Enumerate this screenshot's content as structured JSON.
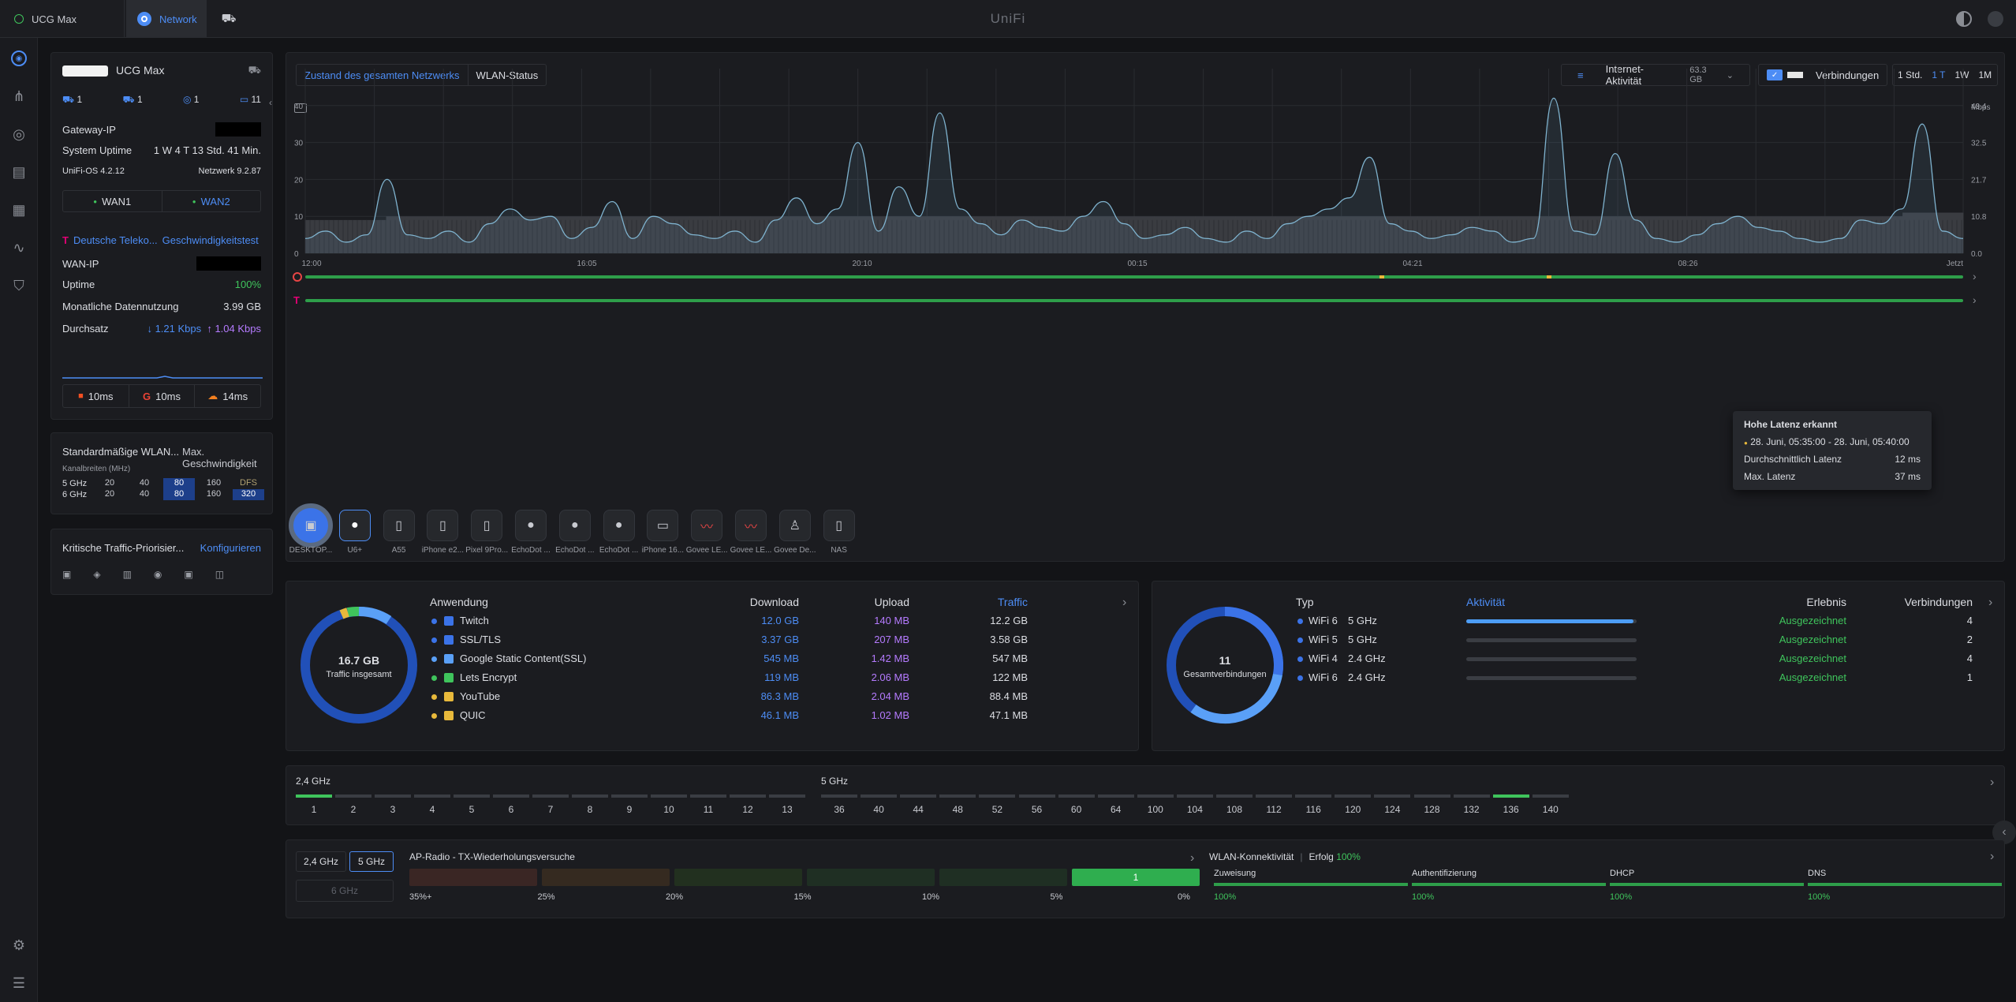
{
  "topbar": {
    "device_tab": "UCG Max",
    "network_tab": "Network",
    "brand": "UniFi"
  },
  "gateway": {
    "name": "UCG Max",
    "counts": [
      "1",
      "1",
      "1",
      "11"
    ],
    "gateway_ip_label": "Gateway-IP",
    "uptime_label": "System Uptime",
    "uptime_value": "1 W 4 T 13 Std. 41 Min.",
    "os_label": "UniFi-OS 4.2.12",
    "network_label": "Netzwerk 9.2.87",
    "wan1": "WAN1",
    "wan2": "WAN2"
  },
  "wan": {
    "isp": "Deutsche Teleko...",
    "speedtest": "Geschwindigkeitstest",
    "wan_ip_label": "WAN-IP",
    "uptime_label": "Uptime",
    "uptime_value": "100%",
    "usage_label": "Monatliche Datennutzung",
    "usage_value": "3.99 GB",
    "throughput_label": "Durchsatz",
    "down": "↓ 1.21 Kbps",
    "up": "↑ 1.04 Kbps",
    "latencies": [
      "10ms",
      "10ms",
      "14ms"
    ]
  },
  "wlan": {
    "title": "Standardmäßige WLAN...",
    "max_speed": "Max. Geschwindigkeit",
    "channel_widths": "Kanalbreiten (MHz)",
    "rows": [
      {
        "band": "5 GHz",
        "values": [
          "20",
          "40",
          "80",
          "160",
          "DFS"
        ]
      },
      {
        "band": "6 GHz",
        "values": [
          "20",
          "40",
          "80",
          "160",
          "320"
        ]
      }
    ]
  },
  "traffic_prio": {
    "title": "Kritische Traffic-Priorisier...",
    "action": "Konfigurieren"
  },
  "chart_toolbar": {
    "tab_overall": "Zustand des gesamten Netzwerks",
    "tab_wlan": "WLAN-Status",
    "internet_activity": "Internet-Aktivität",
    "total": "63.3 GB",
    "connections": "Verbindungen",
    "ranges": [
      "1 Std.",
      "1 T",
      "1W",
      "1M"
    ],
    "unit_right": "Mbps"
  },
  "chart_data": {
    "type": "area",
    "x_ticks": [
      "12:00",
      "16:05",
      "20:10",
      "00:15",
      "04:21",
      "08:26",
      "Jetzt"
    ],
    "y_left_ticks": [
      "0",
      "10",
      "20",
      "30",
      "40"
    ],
    "y_right_ticks": [
      "0.0",
      "10.8",
      "21.7",
      "32.5",
      "43.4"
    ],
    "ylabel_right": "Mbps",
    "series": [
      {
        "name": "Internet-Aktivität",
        "values": [
          4,
          6,
          3,
          5,
          20,
          5,
          4,
          6,
          3,
          8,
          12,
          9,
          10,
          4,
          7,
          14,
          4,
          10,
          8,
          5,
          4,
          6,
          3,
          9,
          15,
          8,
          12,
          30,
          6,
          18,
          10,
          38,
          12,
          8,
          5,
          9,
          7,
          6,
          10,
          14,
          8,
          4,
          5,
          7,
          4,
          3,
          6,
          4,
          8,
          10,
          12,
          15,
          26,
          8,
          6,
          4,
          5,
          7,
          6,
          3,
          4,
          42,
          6,
          5,
          27,
          9,
          4,
          3,
          5,
          8,
          10,
          7,
          6,
          4,
          3,
          4,
          9,
          8,
          12,
          35,
          6,
          4
        ]
      },
      {
        "name": "Verbindungen",
        "values": [
          9,
          9,
          9,
          9,
          10,
          10,
          10,
          10,
          10,
          10,
          10,
          10,
          10,
          10,
          10,
          10,
          10,
          10,
          10,
          10,
          10,
          10,
          10,
          10,
          10,
          10,
          10,
          10,
          10,
          10,
          10,
          10,
          10,
          10,
          10,
          10,
          10,
          10,
          10,
          10,
          10,
          10,
          10,
          10,
          10,
          10,
          10,
          10,
          10,
          10,
          10,
          10,
          10,
          10,
          10,
          10,
          10,
          10,
          10,
          10,
          10,
          10,
          10,
          10,
          10,
          10,
          10,
          10,
          10,
          10,
          10,
          10,
          10,
          10,
          10,
          10,
          10,
          10,
          10,
          11,
          11,
          11
        ]
      }
    ]
  },
  "tooltip": {
    "title": "Hohe Latenz erkannt",
    "range": "28. Juni, 05:35:00 - 28. Juni, 05:40:00",
    "avg_label": "Durchschnittlich Latenz",
    "avg_value": "12 ms",
    "max_label": "Max. Latenz",
    "max_value": "37 ms"
  },
  "devices": [
    "DESKTOP...",
    "U6+",
    "A55",
    "iPhone e2...",
    "Pixel 9Pro...",
    "EchoDot ...",
    "EchoDot ...",
    "EchoDot ...",
    "iPhone 16...",
    "Govee LE...",
    "Govee LE...",
    "Govee De...",
    "NAS"
  ],
  "traffic": {
    "total_value": "16.7 GB",
    "total_label": "Traffic insgesamt",
    "headers": {
      "app": "Anwendung",
      "down": "Download",
      "up": "Upload",
      "traffic": "Traffic"
    },
    "rows": [
      {
        "app": "Twitch",
        "down": "12.0 GB",
        "up": "140 MB",
        "traffic": "12.2 GB",
        "color": "#3b73e8"
      },
      {
        "app": "SSL/TLS",
        "down": "3.37 GB",
        "up": "207 MB",
        "traffic": "3.58 GB",
        "color": "#3b73e8"
      },
      {
        "app": "Google Static Content(SSL)",
        "down": "545 MB",
        "up": "1.42 MB",
        "traffic": "547 MB",
        "color": "#5aa0f7"
      },
      {
        "app": "Lets Encrypt",
        "down": "119 MB",
        "up": "2.06 MB",
        "traffic": "122 MB",
        "color": "#3fc45c"
      },
      {
        "app": "YouTube",
        "down": "86.3 MB",
        "up": "2.04 MB",
        "traffic": "88.4 MB",
        "color": "#e8b93b"
      },
      {
        "app": "QUIC",
        "down": "46.1 MB",
        "up": "1.02 MB",
        "traffic": "47.1 MB",
        "color": "#e8b93b"
      }
    ]
  },
  "connections": {
    "total_value": "11",
    "total_label": "Gesamtverbindungen",
    "headers": {
      "type": "Typ",
      "activity": "Aktivität",
      "experience": "Erlebnis",
      "conn": "Verbindungen"
    },
    "rows": [
      {
        "type": "WiFi 6",
        "band": "5 GHz",
        "activity": 0.98,
        "experience": "Ausgezeichnet",
        "count": "4"
      },
      {
        "type": "WiFi 5",
        "band": "5 GHz",
        "activity": 0.0,
        "experience": "Ausgezeichnet",
        "count": "2"
      },
      {
        "type": "WiFi 4",
        "band": "2.4 GHz",
        "activity": 0.0,
        "experience": "Ausgezeichnet",
        "count": "4"
      },
      {
        "type": "WiFi 6",
        "band": "2.4 GHz",
        "activity": 0.0,
        "experience": "Ausgezeichnet",
        "count": "1"
      }
    ]
  },
  "channels": {
    "band24_label": "2,4 GHz",
    "band5_label": "5 GHz",
    "ch24": [
      "1",
      "2",
      "3",
      "4",
      "5",
      "6",
      "7",
      "8",
      "9",
      "10",
      "11",
      "12",
      "13"
    ],
    "ch5": [
      "36",
      "40",
      "44",
      "48",
      "52",
      "56",
      "60",
      "64",
      "100",
      "104",
      "108",
      "112",
      "116",
      "120",
      "124",
      "128",
      "132",
      "136",
      "140"
    ]
  },
  "ap_radio": {
    "band_a": "2,4 GHz",
    "band_b": "5 GHz",
    "band_c": "6 GHz",
    "title": "AP-Radio - TX-Wiederholungsversuche",
    "labels": [
      "35%+",
      "25%",
      "20%",
      "15%",
      "10%",
      "5%",
      "0%"
    ],
    "active_value": "1"
  },
  "wlan_conn": {
    "title": "WLAN-Konnektivität",
    "success_label": "Erfolg",
    "success_value": "100%",
    "items": [
      {
        "label": "Zuweisung",
        "value": "100%"
      },
      {
        "label": "Authentifizierung",
        "value": "100%"
      },
      {
        "label": "DHCP",
        "value": "100%"
      },
      {
        "label": "DNS",
        "value": "100%"
      }
    ]
  }
}
